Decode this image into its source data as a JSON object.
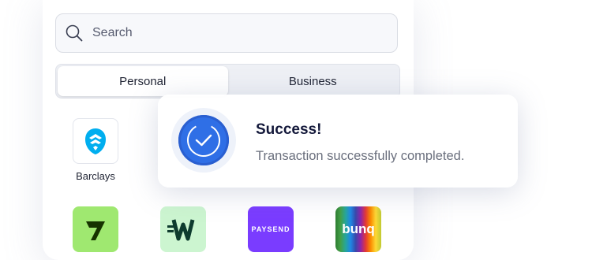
{
  "search": {
    "placeholder": "Search",
    "icon": "search-icon"
  },
  "tabs": [
    {
      "label": "Personal",
      "active": true
    },
    {
      "label": "Business",
      "active": false
    }
  ],
  "banks": {
    "barclays": {
      "name": "Barclays",
      "color": "#00aeef"
    },
    "wise": {
      "color": "#9fe870"
    },
    "wirex": {
      "color": "#ccf5d0"
    },
    "paysend": {
      "logo_text": "PAYSEND",
      "color": "#7a3cff"
    },
    "bunq": {
      "logo_text": "bunq"
    }
  },
  "toast": {
    "title": "Success!",
    "message": "Transaction successfully completed.",
    "icon": "check-icon",
    "accent": "#2f6fe6"
  }
}
